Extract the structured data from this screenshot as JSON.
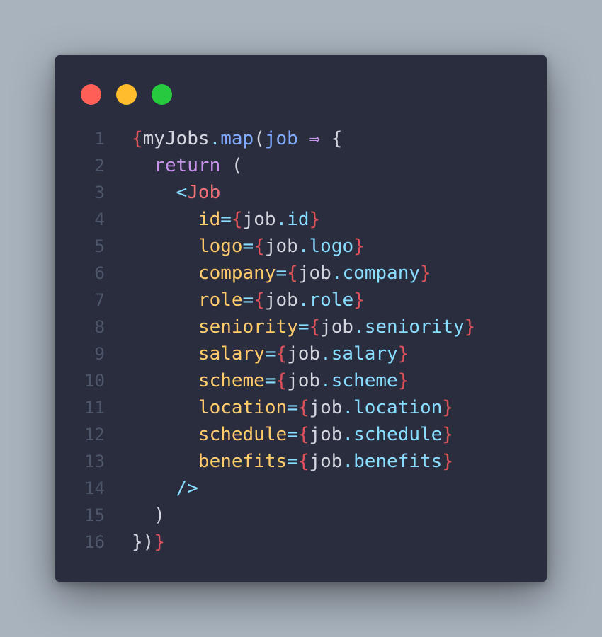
{
  "window": {
    "controls": [
      "close",
      "minimize",
      "maximize"
    ],
    "colors": {
      "close": "#ff5f56",
      "minimize": "#ffbd2e",
      "maximize": "#27c93f",
      "background": "#292d3e",
      "page_background": "#a9b3be"
    }
  },
  "code": {
    "line_numbers": [
      "1",
      "2",
      "3",
      "4",
      "5",
      "6",
      "7",
      "8",
      "9",
      "10",
      "11",
      "12",
      "13",
      "14",
      "15",
      "16"
    ],
    "lines": [
      [
        {
          "t": "{",
          "c": "brace"
        },
        {
          "t": "myJobs",
          "c": "plain"
        },
        {
          "t": ".",
          "c": "op"
        },
        {
          "t": "map",
          "c": "fn"
        },
        {
          "t": "(",
          "c": "plain"
        },
        {
          "t": "job",
          "c": "param"
        },
        {
          "t": " ⇒ ",
          "c": "arrow"
        },
        {
          "t": "{",
          "c": "plain"
        }
      ],
      [
        {
          "t": "  return ",
          "c": "kw"
        },
        {
          "t": "(",
          "c": "plain"
        }
      ],
      [
        {
          "t": "    <",
          "c": "bracket"
        },
        {
          "t": "Job",
          "c": "tag"
        }
      ],
      [
        {
          "t": "      id",
          "c": "attr"
        },
        {
          "t": "=",
          "c": "op"
        },
        {
          "t": "{",
          "c": "brace"
        },
        {
          "t": "job",
          "c": "plain"
        },
        {
          "t": ".",
          "c": "op"
        },
        {
          "t": "id",
          "c": "prop"
        },
        {
          "t": "}",
          "c": "brace"
        }
      ],
      [
        {
          "t": "      logo",
          "c": "attr"
        },
        {
          "t": "=",
          "c": "op"
        },
        {
          "t": "{",
          "c": "brace"
        },
        {
          "t": "job",
          "c": "plain"
        },
        {
          "t": ".",
          "c": "op"
        },
        {
          "t": "logo",
          "c": "prop"
        },
        {
          "t": "}",
          "c": "brace"
        }
      ],
      [
        {
          "t": "      company",
          "c": "attr"
        },
        {
          "t": "=",
          "c": "op"
        },
        {
          "t": "{",
          "c": "brace"
        },
        {
          "t": "job",
          "c": "plain"
        },
        {
          "t": ".",
          "c": "op"
        },
        {
          "t": "company",
          "c": "prop"
        },
        {
          "t": "}",
          "c": "brace"
        }
      ],
      [
        {
          "t": "      role",
          "c": "attr"
        },
        {
          "t": "=",
          "c": "op"
        },
        {
          "t": "{",
          "c": "brace"
        },
        {
          "t": "job",
          "c": "plain"
        },
        {
          "t": ".",
          "c": "op"
        },
        {
          "t": "role",
          "c": "prop"
        },
        {
          "t": "}",
          "c": "brace"
        }
      ],
      [
        {
          "t": "      seniority",
          "c": "attr"
        },
        {
          "t": "=",
          "c": "op"
        },
        {
          "t": "{",
          "c": "brace"
        },
        {
          "t": "job",
          "c": "plain"
        },
        {
          "t": ".",
          "c": "op"
        },
        {
          "t": "seniority",
          "c": "prop"
        },
        {
          "t": "}",
          "c": "brace"
        }
      ],
      [
        {
          "t": "      salary",
          "c": "attr"
        },
        {
          "t": "=",
          "c": "op"
        },
        {
          "t": "{",
          "c": "brace"
        },
        {
          "t": "job",
          "c": "plain"
        },
        {
          "t": ".",
          "c": "op"
        },
        {
          "t": "salary",
          "c": "prop"
        },
        {
          "t": "}",
          "c": "brace"
        }
      ],
      [
        {
          "t": "      scheme",
          "c": "attr"
        },
        {
          "t": "=",
          "c": "op"
        },
        {
          "t": "{",
          "c": "brace"
        },
        {
          "t": "job",
          "c": "plain"
        },
        {
          "t": ".",
          "c": "op"
        },
        {
          "t": "scheme",
          "c": "prop"
        },
        {
          "t": "}",
          "c": "brace"
        }
      ],
      [
        {
          "t": "      location",
          "c": "attr"
        },
        {
          "t": "=",
          "c": "op"
        },
        {
          "t": "{",
          "c": "brace"
        },
        {
          "t": "job",
          "c": "plain"
        },
        {
          "t": ".",
          "c": "op"
        },
        {
          "t": "location",
          "c": "prop"
        },
        {
          "t": "}",
          "c": "brace"
        }
      ],
      [
        {
          "t": "      schedule",
          "c": "attr"
        },
        {
          "t": "=",
          "c": "op"
        },
        {
          "t": "{",
          "c": "brace"
        },
        {
          "t": "job",
          "c": "plain"
        },
        {
          "t": ".",
          "c": "op"
        },
        {
          "t": "schedule",
          "c": "prop"
        },
        {
          "t": "}",
          "c": "brace"
        }
      ],
      [
        {
          "t": "      benefits",
          "c": "attr"
        },
        {
          "t": "=",
          "c": "op"
        },
        {
          "t": "{",
          "c": "brace"
        },
        {
          "t": "job",
          "c": "plain"
        },
        {
          "t": ".",
          "c": "op"
        },
        {
          "t": "benefits",
          "c": "prop"
        },
        {
          "t": "}",
          "c": "brace"
        }
      ],
      [
        {
          "t": "    />",
          "c": "bracket"
        }
      ],
      [
        {
          "t": "  )",
          "c": "plain"
        }
      ],
      [
        {
          "t": "})",
          "c": "plain"
        },
        {
          "t": "}",
          "c": "brace"
        }
      ]
    ]
  }
}
